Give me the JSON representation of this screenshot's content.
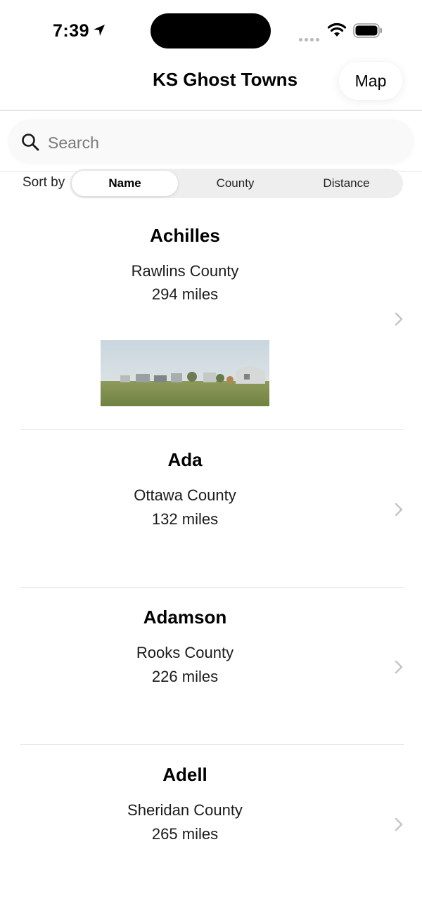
{
  "status_bar": {
    "time": "7:39"
  },
  "nav": {
    "title": "KS Ghost Towns",
    "map_button": "Map"
  },
  "search": {
    "placeholder": "Search",
    "value": ""
  },
  "sort": {
    "label": "Sort by",
    "options": [
      "Name",
      "County",
      "Distance"
    ],
    "selected": "Name"
  },
  "towns": [
    {
      "name": "Achilles",
      "county": "Rawlins County",
      "distance": "294 miles",
      "has_photo": true
    },
    {
      "name": "Ada",
      "county": "Ottawa County",
      "distance": "132 miles",
      "has_photo": false
    },
    {
      "name": "Adamson",
      "county": "Rooks County",
      "distance": "226 miles",
      "has_photo": false
    },
    {
      "name": "Adell",
      "county": "Sheridan County",
      "distance": "265 miles",
      "has_photo": false
    }
  ],
  "icons": {
    "location": "location-arrow-icon",
    "wifi": "wifi-icon",
    "battery": "battery-icon",
    "search": "search-icon",
    "chevron": "chevron-right-icon"
  },
  "colors": {
    "background": "#ffffff",
    "segment_track": "#eeeeef",
    "chevron": "#c4c4c7",
    "divider": "#e2e2e2"
  }
}
